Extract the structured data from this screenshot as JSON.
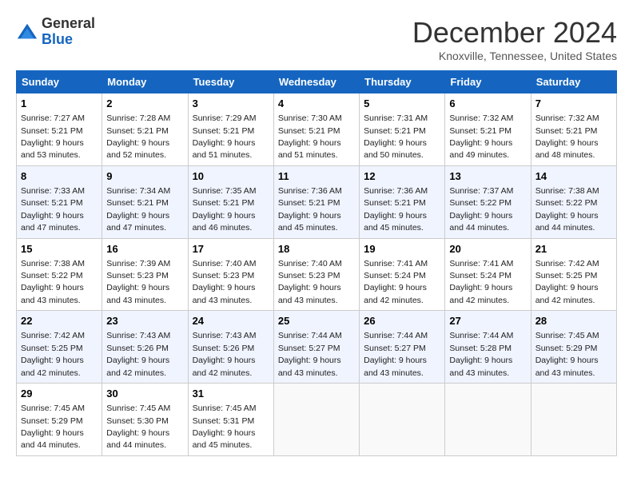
{
  "logo": {
    "general": "General",
    "blue": "Blue"
  },
  "title": "December 2024",
  "subtitle": "Knoxville, Tennessee, United States",
  "headers": [
    "Sunday",
    "Monday",
    "Tuesday",
    "Wednesday",
    "Thursday",
    "Friday",
    "Saturday"
  ],
  "weeks": [
    [
      {
        "day": "1",
        "sunrise": "7:27 AM",
        "sunset": "5:21 PM",
        "daylight": "9 hours and 53 minutes."
      },
      {
        "day": "2",
        "sunrise": "7:28 AM",
        "sunset": "5:21 PM",
        "daylight": "9 hours and 52 minutes."
      },
      {
        "day": "3",
        "sunrise": "7:29 AM",
        "sunset": "5:21 PM",
        "daylight": "9 hours and 51 minutes."
      },
      {
        "day": "4",
        "sunrise": "7:30 AM",
        "sunset": "5:21 PM",
        "daylight": "9 hours and 51 minutes."
      },
      {
        "day": "5",
        "sunrise": "7:31 AM",
        "sunset": "5:21 PM",
        "daylight": "9 hours and 50 minutes."
      },
      {
        "day": "6",
        "sunrise": "7:32 AM",
        "sunset": "5:21 PM",
        "daylight": "9 hours and 49 minutes."
      },
      {
        "day": "7",
        "sunrise": "7:32 AM",
        "sunset": "5:21 PM",
        "daylight": "9 hours and 48 minutes."
      }
    ],
    [
      {
        "day": "8",
        "sunrise": "7:33 AM",
        "sunset": "5:21 PM",
        "daylight": "9 hours and 47 minutes."
      },
      {
        "day": "9",
        "sunrise": "7:34 AM",
        "sunset": "5:21 PM",
        "daylight": "9 hours and 47 minutes."
      },
      {
        "day": "10",
        "sunrise": "7:35 AM",
        "sunset": "5:21 PM",
        "daylight": "9 hours and 46 minutes."
      },
      {
        "day": "11",
        "sunrise": "7:36 AM",
        "sunset": "5:21 PM",
        "daylight": "9 hours and 45 minutes."
      },
      {
        "day": "12",
        "sunrise": "7:36 AM",
        "sunset": "5:21 PM",
        "daylight": "9 hours and 45 minutes."
      },
      {
        "day": "13",
        "sunrise": "7:37 AM",
        "sunset": "5:22 PM",
        "daylight": "9 hours and 44 minutes."
      },
      {
        "day": "14",
        "sunrise": "7:38 AM",
        "sunset": "5:22 PM",
        "daylight": "9 hours and 44 minutes."
      }
    ],
    [
      {
        "day": "15",
        "sunrise": "7:38 AM",
        "sunset": "5:22 PM",
        "daylight": "9 hours and 43 minutes."
      },
      {
        "day": "16",
        "sunrise": "7:39 AM",
        "sunset": "5:23 PM",
        "daylight": "9 hours and 43 minutes."
      },
      {
        "day": "17",
        "sunrise": "7:40 AM",
        "sunset": "5:23 PM",
        "daylight": "9 hours and 43 minutes."
      },
      {
        "day": "18",
        "sunrise": "7:40 AM",
        "sunset": "5:23 PM",
        "daylight": "9 hours and 43 minutes."
      },
      {
        "day": "19",
        "sunrise": "7:41 AM",
        "sunset": "5:24 PM",
        "daylight": "9 hours and 42 minutes."
      },
      {
        "day": "20",
        "sunrise": "7:41 AM",
        "sunset": "5:24 PM",
        "daylight": "9 hours and 42 minutes."
      },
      {
        "day": "21",
        "sunrise": "7:42 AM",
        "sunset": "5:25 PM",
        "daylight": "9 hours and 42 minutes."
      }
    ],
    [
      {
        "day": "22",
        "sunrise": "7:42 AM",
        "sunset": "5:25 PM",
        "daylight": "9 hours and 42 minutes."
      },
      {
        "day": "23",
        "sunrise": "7:43 AM",
        "sunset": "5:26 PM",
        "daylight": "9 hours and 42 minutes."
      },
      {
        "day": "24",
        "sunrise": "7:43 AM",
        "sunset": "5:26 PM",
        "daylight": "9 hours and 42 minutes."
      },
      {
        "day": "25",
        "sunrise": "7:44 AM",
        "sunset": "5:27 PM",
        "daylight": "9 hours and 43 minutes."
      },
      {
        "day": "26",
        "sunrise": "7:44 AM",
        "sunset": "5:27 PM",
        "daylight": "9 hours and 43 minutes."
      },
      {
        "day": "27",
        "sunrise": "7:44 AM",
        "sunset": "5:28 PM",
        "daylight": "9 hours and 43 minutes."
      },
      {
        "day": "28",
        "sunrise": "7:45 AM",
        "sunset": "5:29 PM",
        "daylight": "9 hours and 43 minutes."
      }
    ],
    [
      {
        "day": "29",
        "sunrise": "7:45 AM",
        "sunset": "5:29 PM",
        "daylight": "9 hours and 44 minutes."
      },
      {
        "day": "30",
        "sunrise": "7:45 AM",
        "sunset": "5:30 PM",
        "daylight": "9 hours and 44 minutes."
      },
      {
        "day": "31",
        "sunrise": "7:45 AM",
        "sunset": "5:31 PM",
        "daylight": "9 hours and 45 minutes."
      },
      null,
      null,
      null,
      null
    ]
  ],
  "labels": {
    "sunrise": "Sunrise:",
    "sunset": "Sunset:",
    "daylight": "Daylight:"
  }
}
